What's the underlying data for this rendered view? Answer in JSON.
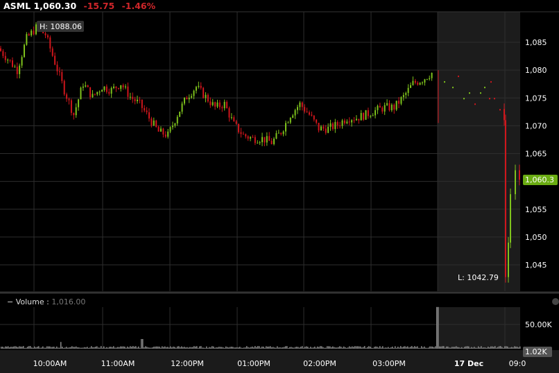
{
  "header": {
    "symbol": "ASML",
    "price": "1,060.30",
    "change": "-15.75",
    "change_pct": "-1.46%"
  },
  "volume_panel": {
    "collapse": "−",
    "label": "Volume",
    "sep": ":",
    "value": "1,016.00"
  },
  "colors": {
    "up": "#7fc31c",
    "down": "#d0161c",
    "grid": "#2e2e2e",
    "shade": "#1c1c1c",
    "last_badge": "#6aac12"
  },
  "chart_data": [
    {
      "type": "candlestick",
      "title": "ASML",
      "ylim": [
        1040,
        1090
      ],
      "yticks": [
        "1,085",
        "1,080",
        "1,075",
        "1,070",
        "1,065",
        "1,060",
        "1,055",
        "1,050",
        "1,045"
      ],
      "ytick_values": [
        1085,
        1080,
        1075,
        1070,
        1065,
        1060,
        1055,
        1050,
        1045
      ],
      "xticks": [
        "10:00AM",
        "11:00AM",
        "12:00PM",
        "01:00PM",
        "02:00PM",
        "03:00PM",
        "17 Dec",
        "09:0"
      ],
      "high_label": "H: 1088.06",
      "low_label": "L: 1042.79",
      "last_label": "1,060.3",
      "regular_session_closes": [
        1083.9,
        1082,
        1080,
        1085.7,
        1087.6,
        1086.4,
        1081.4,
        1076.4,
        1072,
        1077.6,
        1075.2,
        1077,
        1076.4,
        1077.6,
        1075.2,
        1073.9,
        1071.4,
        1068.9,
        1068.3,
        1072,
        1075.2,
        1077,
        1075.2,
        1073.3,
        1073.9,
        1070.2,
        1068.3,
        1067.7,
        1067.7,
        1067,
        1068.9,
        1072,
        1073.9,
        1072,
        1069.5,
        1069.5,
        1070.2,
        1071.4,
        1071.4,
        1072,
        1072.7,
        1073.3,
        1073.3,
        1075.2,
        1077.6,
        1078.3,
        1079.5
      ],
      "extended_session_closes": [
        1071,
        1078,
        1077,
        1079,
        1075,
        1076,
        1074,
        1076,
        1077,
        1075,
        1078,
        1075,
        1073,
        1071,
        1042.8,
        1049,
        1057.7,
        1062,
        1060.3
      ]
    },
    {
      "type": "bar",
      "title": "Volume",
      "yticks": [
        "50.00K"
      ],
      "last_label": "1.02K",
      "spike_value_k": 86,
      "typical_value_k": 4
    }
  ]
}
